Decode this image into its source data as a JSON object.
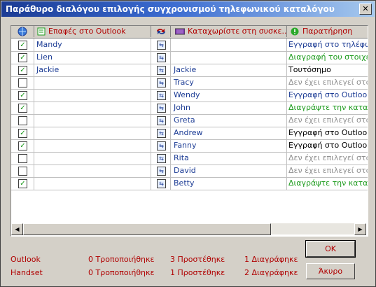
{
  "window": {
    "title": "Παράθυρο διαλόγου επιλογής συγχρονισμού τηλεφωνικού καταλόγου",
    "close": "✕"
  },
  "columns": {
    "outlook": "Επαφές στο Outlook",
    "handset": "Καταχωρίστε στη συσκε...",
    "note": "Παρατήρηση"
  },
  "icons": {
    "globe": "globe-icon",
    "contacts": "contacts-icon",
    "sync": "sync-icon",
    "handset": "handset-icon",
    "warning": "warning-icon"
  },
  "rows": [
    {
      "checked": true,
      "outlook": "Mandy",
      "handset": "",
      "note": "Εγγραφή στο τηλέφω",
      "note_color": "#1b3b94"
    },
    {
      "checked": true,
      "outlook": "Lien",
      "handset": "",
      "note": "Διαγραφή του στοιχε",
      "note_color": "#1a9a1a"
    },
    {
      "checked": true,
      "outlook": "Jackie",
      "handset": "Jackie",
      "note": "Τουτόσημο",
      "note_color": "#000000"
    },
    {
      "checked": false,
      "outlook": "",
      "handset": "Tracy",
      "note": "Δεν έχει επιλεγεί στο",
      "note_color": "#909090"
    },
    {
      "checked": true,
      "outlook": "",
      "handset": "Wendy",
      "note": "Εγγραφή στο Outlook",
      "note_color": "#1b3b94"
    },
    {
      "checked": true,
      "outlook": "",
      "handset": "John",
      "note": "Διαγράψτε την καταχ",
      "note_color": "#1a9a1a"
    },
    {
      "checked": false,
      "outlook": "",
      "handset": "Greta",
      "note": "Δεν έχει επιλεγεί στο",
      "note_color": "#909090"
    },
    {
      "checked": true,
      "outlook": "",
      "handset": "Andrew",
      "note": "Εγγραφή στο Outlook",
      "note_color": "#000000"
    },
    {
      "checked": true,
      "outlook": "",
      "handset": "Fanny",
      "note": "Εγγραφή στο Outlook",
      "note_color": "#000000"
    },
    {
      "checked": false,
      "outlook": "",
      "handset": "Rita",
      "note": "Δεν έχει επιλεγεί στο",
      "note_color": "#909090"
    },
    {
      "checked": false,
      "outlook": "",
      "handset": "David",
      "note": "Δεν έχει επιλεγεί στο",
      "note_color": "#909090"
    },
    {
      "checked": true,
      "outlook": "",
      "handset": "Betty",
      "note": "Διαγράψτε την καταχ",
      "note_color": "#1a9a1a"
    }
  ],
  "summary": {
    "outlook": {
      "label": "Outlook",
      "modified": "0 Τροποποιήθηκε",
      "added": "3 Προστέθηκε",
      "deleted": "1 Διαγράφηκε"
    },
    "handset": {
      "label": "Handset",
      "modified": "0 Τροποποιήθηκε",
      "added": "1 Προστέθηκε",
      "deleted": "2 Διαγράφηκε"
    }
  },
  "buttons": {
    "ok": "OK",
    "cancel": "Άκυρο"
  },
  "colors": {
    "accent": "#1b3b94",
    "label_red": "#b00000",
    "green": "#1a9a1a"
  }
}
